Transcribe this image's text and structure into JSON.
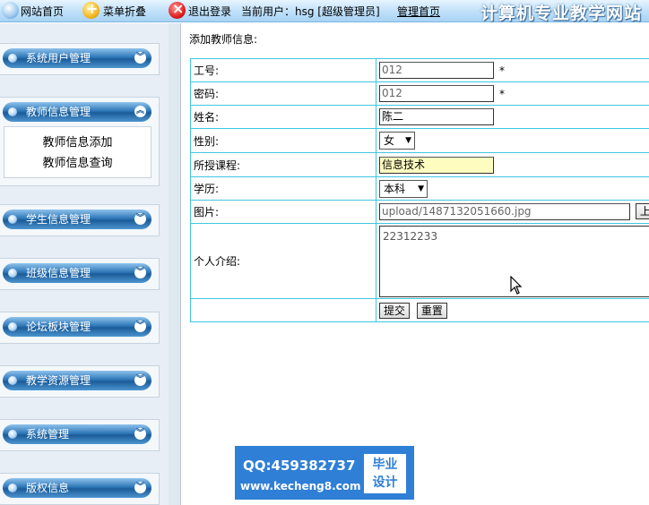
{
  "topbar": {
    "home": "网站首页",
    "fold_menu": "菜单折叠",
    "logout": "退出登录",
    "current_user": "当前用户：hsg [超级管理员]",
    "admin_home": "管理首页",
    "site_title": "计算机专业教学网站"
  },
  "sidebar": {
    "menus": [
      {
        "label": "系统用户管理"
      },
      {
        "label": "教师信息管理",
        "expanded": true,
        "items": [
          "教师信息添加",
          "教师信息查询"
        ]
      },
      {
        "label": "学生信息管理"
      },
      {
        "label": "班级信息管理"
      },
      {
        "label": "论坛板块管理"
      },
      {
        "label": "教学资源管理"
      },
      {
        "label": "系统管理"
      },
      {
        "label": "版权信息"
      }
    ]
  },
  "form": {
    "title": "添加教师信息:",
    "required_mark": "*",
    "fields": {
      "teacher_no": {
        "label": "工号:",
        "value": "012"
      },
      "password": {
        "label": "密码:",
        "value": "012"
      },
      "name": {
        "label": "姓名:",
        "value": "陈二"
      },
      "gender": {
        "label": "性别:",
        "value": "女"
      },
      "course": {
        "label": "所授课程:",
        "value": "信息技术"
      },
      "education": {
        "label": "学历:",
        "value": "本科"
      },
      "photo": {
        "label": "图片:",
        "value": "upload/1487132051660.jpg",
        "upload_button": "上"
      },
      "intro": {
        "label": "个人介绍:",
        "value": "22312233"
      }
    },
    "submit_label": "提交",
    "reset_label": "重置"
  },
  "watermark": {
    "qq": "QQ:459382737",
    "url": "www.kecheng8.com",
    "badge_line1": "毕业",
    "badge_line2": "设计"
  },
  "colors": {
    "table_border": "#3fc6e0",
    "menu_head": "#2e77b8",
    "course_highlight": "#fffcc0",
    "watermark_bg": "#2f7fd6"
  }
}
